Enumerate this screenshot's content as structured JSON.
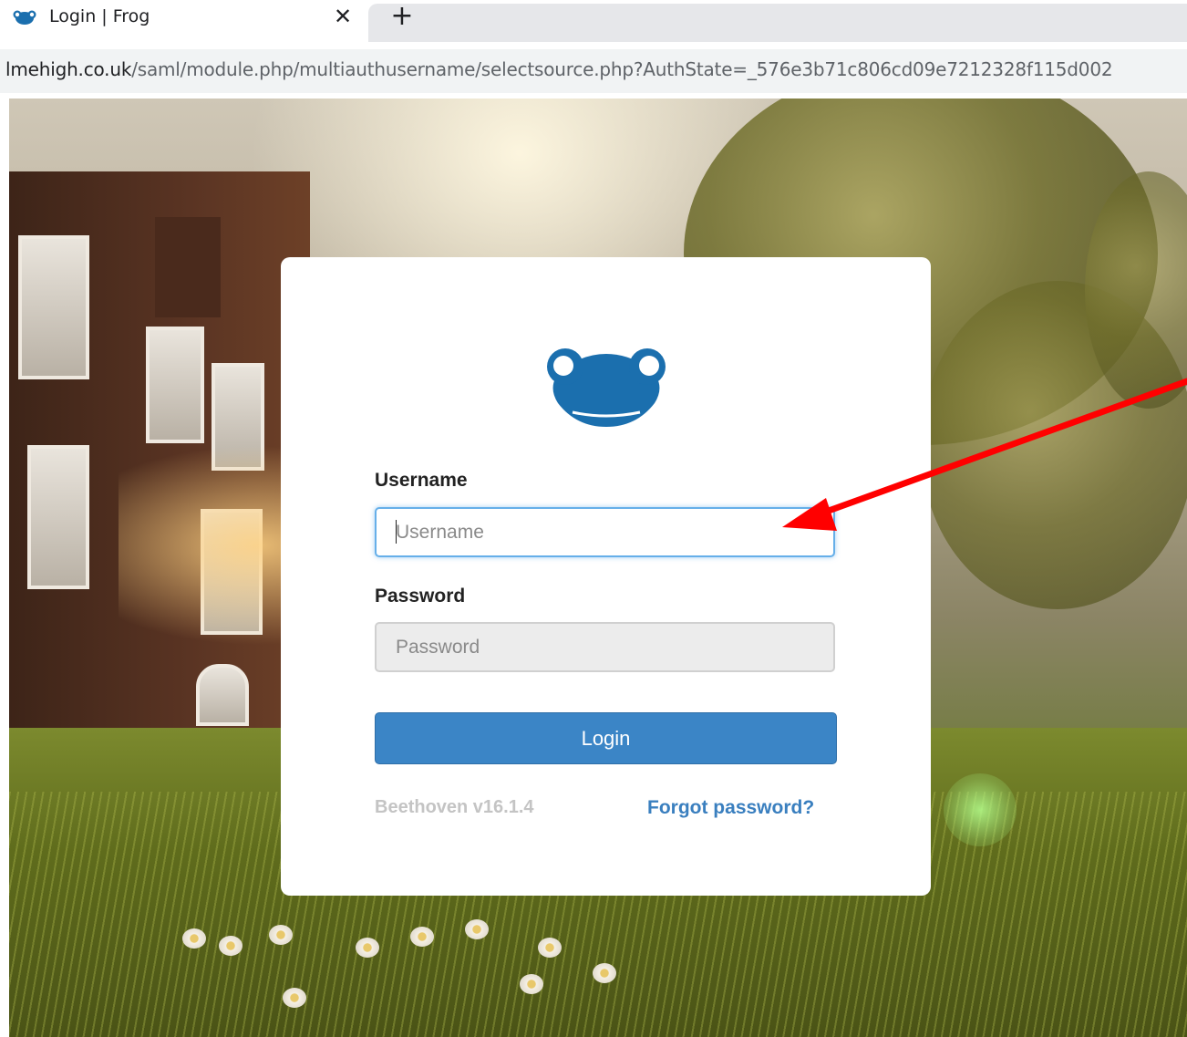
{
  "browser": {
    "tab": {
      "title": "Login | Frog",
      "favicon": "frog-logo-icon",
      "close_glyph": "✕"
    },
    "new_tab_glyph": "+",
    "address": {
      "host": "lmehigh.co.uk",
      "path": "/saml/module.php/multiauthusername/selectsource.php?AuthState=_576e3b71c806cd09e7212328f115d002"
    }
  },
  "login": {
    "logo": "frog-logo-icon",
    "username_label": "Username",
    "username_placeholder": "Username",
    "username_value": "",
    "password_label": "Password",
    "password_placeholder": "Password",
    "password_value": "",
    "login_button": "Login",
    "version": "Beethoven v16.1.4",
    "forgot_password": "Forgot password?"
  },
  "colors": {
    "brand_blue": "#1b6fae",
    "button_blue": "#3b85c6",
    "link_blue": "#3a7fbf",
    "focus_border": "#66afe9",
    "annotation_arrow": "#ff0000"
  },
  "annotation": {
    "type": "arrow",
    "points_to": "username-input"
  }
}
